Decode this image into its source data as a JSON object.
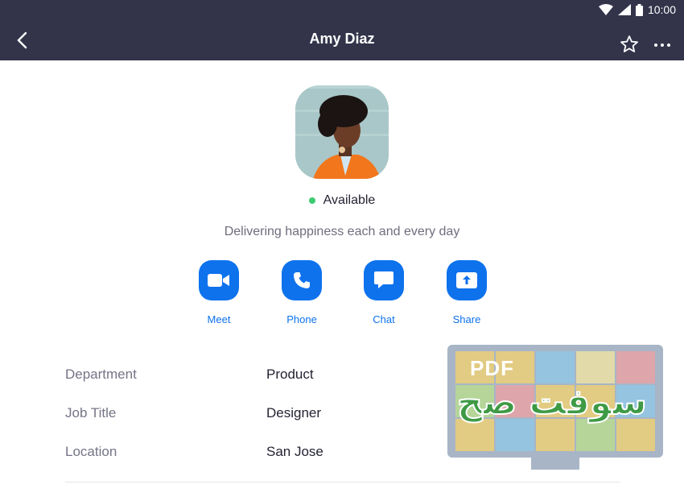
{
  "status_bar": {
    "time": "10:00"
  },
  "header": {
    "title": "Amy Diaz"
  },
  "profile": {
    "status": "Available",
    "status_color": "#3ccb70",
    "tagline": "Delivering happiness each and every day"
  },
  "actions": [
    {
      "label": "Meet",
      "icon": "video-camera-icon"
    },
    {
      "label": "Phone",
      "icon": "phone-icon"
    },
    {
      "label": "Chat",
      "icon": "chat-bubble-icon"
    },
    {
      "label": "Share",
      "icon": "share-screen-icon"
    }
  ],
  "details": [
    {
      "key": "Department",
      "value": "Product"
    },
    {
      "key": "Job Title",
      "value": "Designer"
    },
    {
      "key": "Location",
      "value": "San Jose"
    }
  ],
  "watermark": {
    "text_latin": "PDF",
    "text_arabic": "سوفت صح"
  },
  "colors": {
    "header_bg": "#33344a",
    "accent": "#0e72ed"
  }
}
